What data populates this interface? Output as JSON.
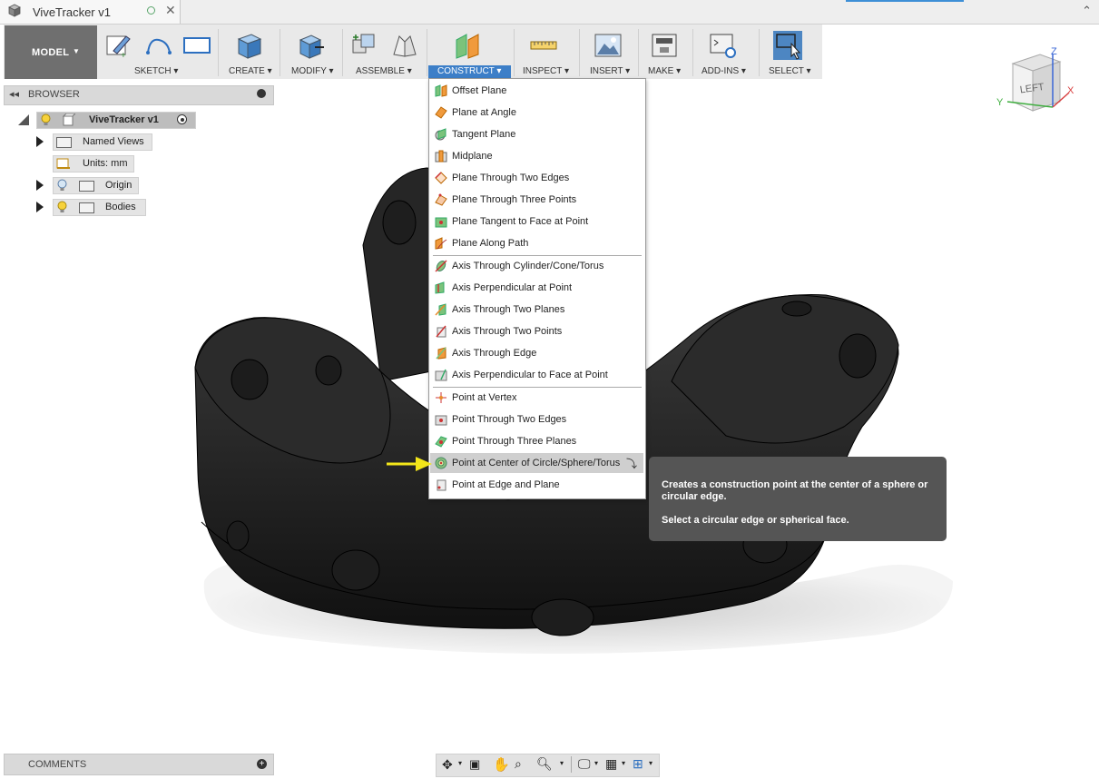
{
  "window": {
    "tab_title": "ViveTracker v1",
    "collapse_icon": "chevron-up-icon"
  },
  "toolbar": {
    "workspace": "MODEL",
    "groups": [
      {
        "label": "SKETCH",
        "icon": "sketch-icon"
      },
      {
        "label": "CREATE",
        "icon": "create-box-icon"
      },
      {
        "label": "MODIFY",
        "icon": "modify-icon"
      },
      {
        "label": "ASSEMBLE",
        "icon": "assemble-icon"
      },
      {
        "label": "CONSTRUCT",
        "icon": "construct-plane-icon"
      },
      {
        "label": "INSPECT",
        "icon": "measure-icon"
      },
      {
        "label": "INSERT",
        "icon": "insert-image-icon"
      },
      {
        "label": "MAKE",
        "icon": "3d-print-icon"
      },
      {
        "label": "ADD-INS",
        "icon": "scripts-icon"
      },
      {
        "label": "SELECT",
        "icon": "select-cursor-icon"
      }
    ],
    "active_color": "#3d7fc8"
  },
  "browser": {
    "title": "BROWSER",
    "root": "ViveTracker v1",
    "items": [
      {
        "label": "Named Views"
      },
      {
        "label": "Units: mm"
      },
      {
        "label": "Origin"
      },
      {
        "label": "Bodies"
      }
    ]
  },
  "construct_menu": {
    "planes": [
      "Offset Plane",
      "Plane at Angle",
      "Tangent Plane",
      "Midplane",
      "Plane Through Two Edges",
      "Plane Through Three Points",
      "Plane Tangent to Face at Point",
      "Plane Along Path"
    ],
    "axes": [
      "Axis Through Cylinder/Cone/Torus",
      "Axis Perpendicular at Point",
      "Axis Through Two Planes",
      "Axis Through Two Points",
      "Axis Through Edge",
      "Axis Perpendicular to Face at Point"
    ],
    "points": [
      "Point at Vertex",
      "Point Through Two Edges",
      "Point Through Three Planes",
      "Point at Center of Circle/Sphere/Torus",
      "Point at Edge and Plane"
    ],
    "highlighted": "Point at Center of Circle/Sphere/Torus"
  },
  "tooltip": {
    "line1": "Creates a construction point at the center of a sphere or circular edge.",
    "line2": "Select a circular edge or spherical face."
  },
  "viewcube": {
    "face": "LEFT",
    "axis_z": "Z",
    "axis_x": "X",
    "axis_y": "Y"
  },
  "comments": {
    "title": "COMMENTS"
  },
  "annotation_arrow_color": "#f3e61a"
}
